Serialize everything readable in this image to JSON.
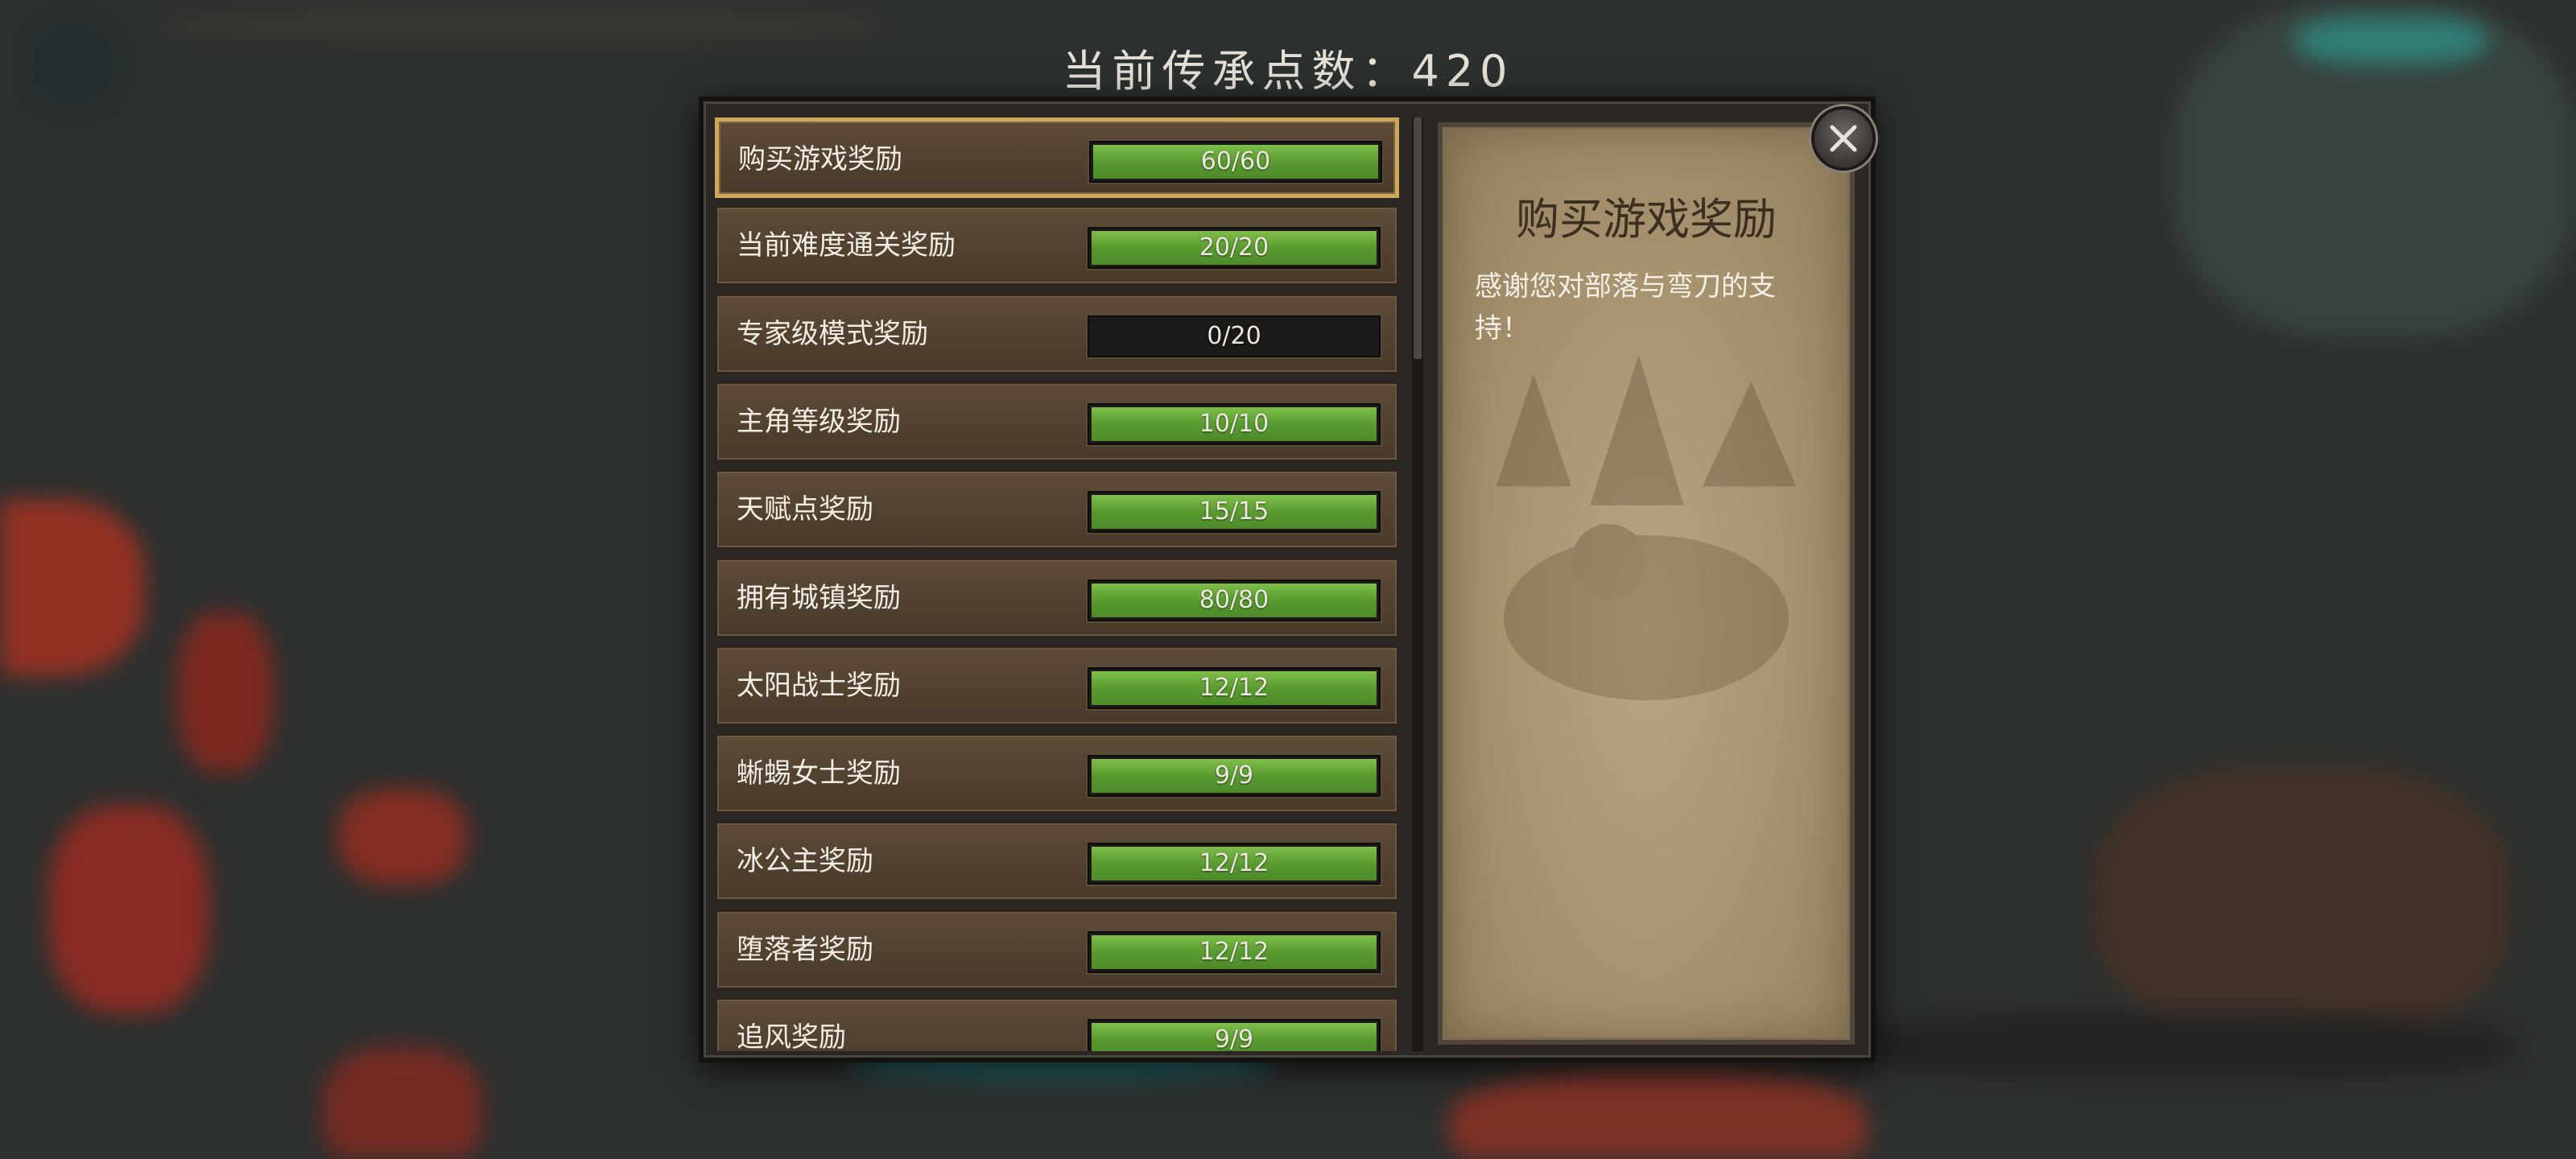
{
  "header": {
    "legacy_points_label": "当前传承点数：420"
  },
  "rewards": [
    {
      "label": "购买游戏奖励",
      "progress": "60/60",
      "fraction": 1.0,
      "selected": true
    },
    {
      "label": "当前难度通关奖励",
      "progress": "20/20",
      "fraction": 1.0
    },
    {
      "label": "专家级模式奖励",
      "progress": "0/20",
      "fraction": 0.0
    },
    {
      "label": "主角等级奖励",
      "progress": "10/10",
      "fraction": 1.0
    },
    {
      "label": "天赋点奖励",
      "progress": "15/15",
      "fraction": 1.0
    },
    {
      "label": "拥有城镇奖励",
      "progress": "80/80",
      "fraction": 1.0
    },
    {
      "label": "太阳战士奖励",
      "progress": "12/12",
      "fraction": 1.0
    },
    {
      "label": "蜥蜴女士奖励",
      "progress": "9/9",
      "fraction": 1.0
    },
    {
      "label": "冰公主奖励",
      "progress": "12/12",
      "fraction": 1.0
    },
    {
      "label": "堕落者奖励",
      "progress": "12/12",
      "fraction": 1.0
    },
    {
      "label": "追风奖励",
      "progress": "9/9",
      "fraction": 1.0
    }
  ],
  "detail": {
    "title": "购买游戏奖励",
    "description": "感谢您对部落与弯刀的支持！"
  },
  "icons": {
    "close": "close-icon"
  },
  "colors": {
    "selected_border": "#cda857",
    "progress_fill": "#6aa83a",
    "accent_lava": "#e0402a"
  }
}
